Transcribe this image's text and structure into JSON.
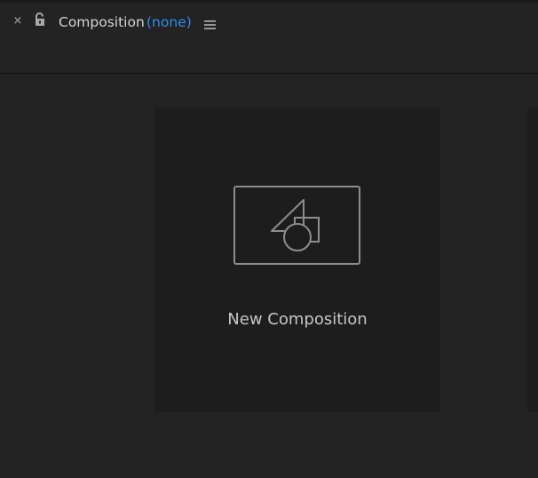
{
  "panel": {
    "close_glyph": "×",
    "title": "Composition",
    "composition_name": "(none)",
    "accent_color": "#2d8ceb",
    "icons": [
      "close-icon",
      "lock-icon",
      "panel-menu-icon"
    ]
  },
  "start_tiles": [
    {
      "label": "New Composition",
      "icon": "new-composition-icon"
    }
  ]
}
